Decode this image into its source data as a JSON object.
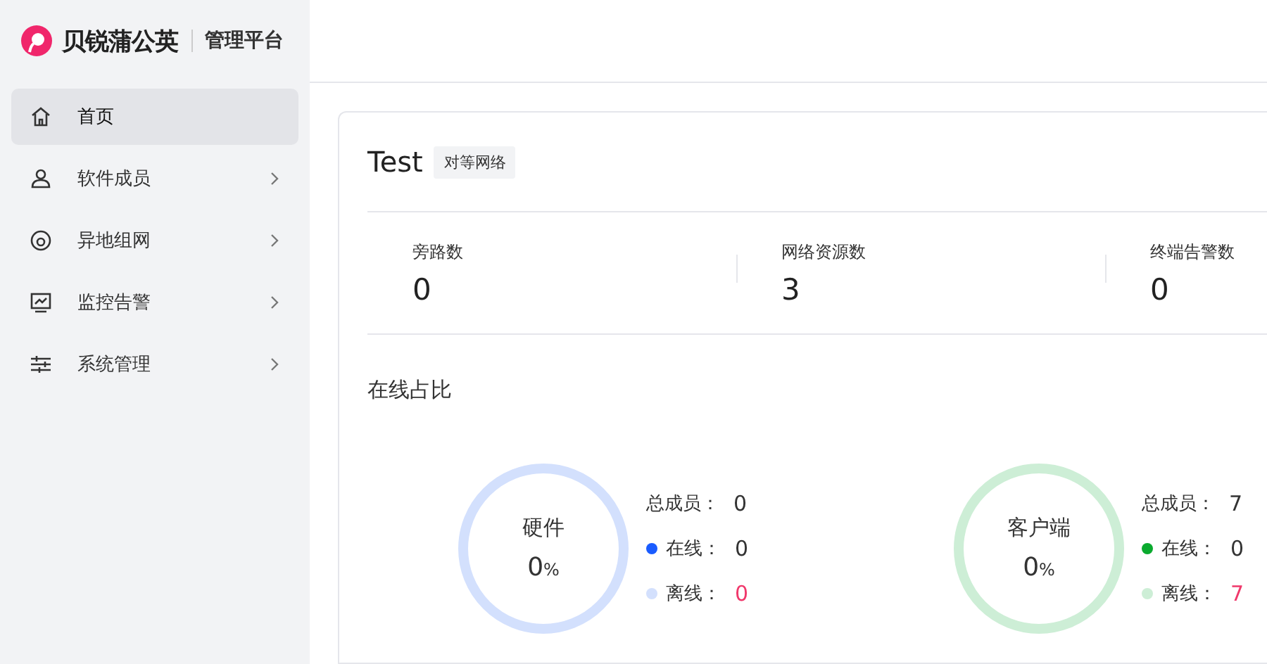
{
  "logo": {
    "brand": "贝锐蒲公英",
    "product": "管理平台"
  },
  "sidebar": {
    "items": [
      {
        "label": "首页",
        "selected": true,
        "has_children": false
      },
      {
        "label": "软件成员",
        "selected": false,
        "has_children": true
      },
      {
        "label": "异地组网",
        "selected": false,
        "has_children": true
      },
      {
        "label": "监控告警",
        "selected": false,
        "has_children": true
      },
      {
        "label": "系统管理",
        "selected": false,
        "has_children": true
      }
    ]
  },
  "network": {
    "name": "Test",
    "tag": "对等网络"
  },
  "stats": [
    {
      "label": "旁路数",
      "value": "0"
    },
    {
      "label": "网络资源数",
      "value": "3"
    },
    {
      "label": "终端告警数",
      "value": "0"
    }
  ],
  "online_ratio": {
    "title": "在线占比",
    "groups": [
      {
        "name": "硬件",
        "percent": "0",
        "unit": "%",
        "level": 0,
        "legend": [
          {
            "label": "总成员：",
            "value": "0",
            "kind": "total"
          },
          {
            "label": "在线：",
            "value": "0",
            "kind": "online",
            "color": "#1a5cff"
          },
          {
            "label": "离线：",
            "value": "0",
            "kind": "offline",
            "color": "#d3e0fd"
          }
        ]
      },
      {
        "name": "客户端",
        "percent": "0",
        "unit": "%",
        "level": 0,
        "legend": [
          {
            "label": "总成员：",
            "value": "7",
            "kind": "total"
          },
          {
            "label": "在线：",
            "value": "0",
            "kind": "online",
            "color": "#0aaa2e"
          },
          {
            "label": "离线：",
            "value": "7",
            "kind": "offline",
            "color": "#cdeed6"
          }
        ]
      }
    ]
  }
}
